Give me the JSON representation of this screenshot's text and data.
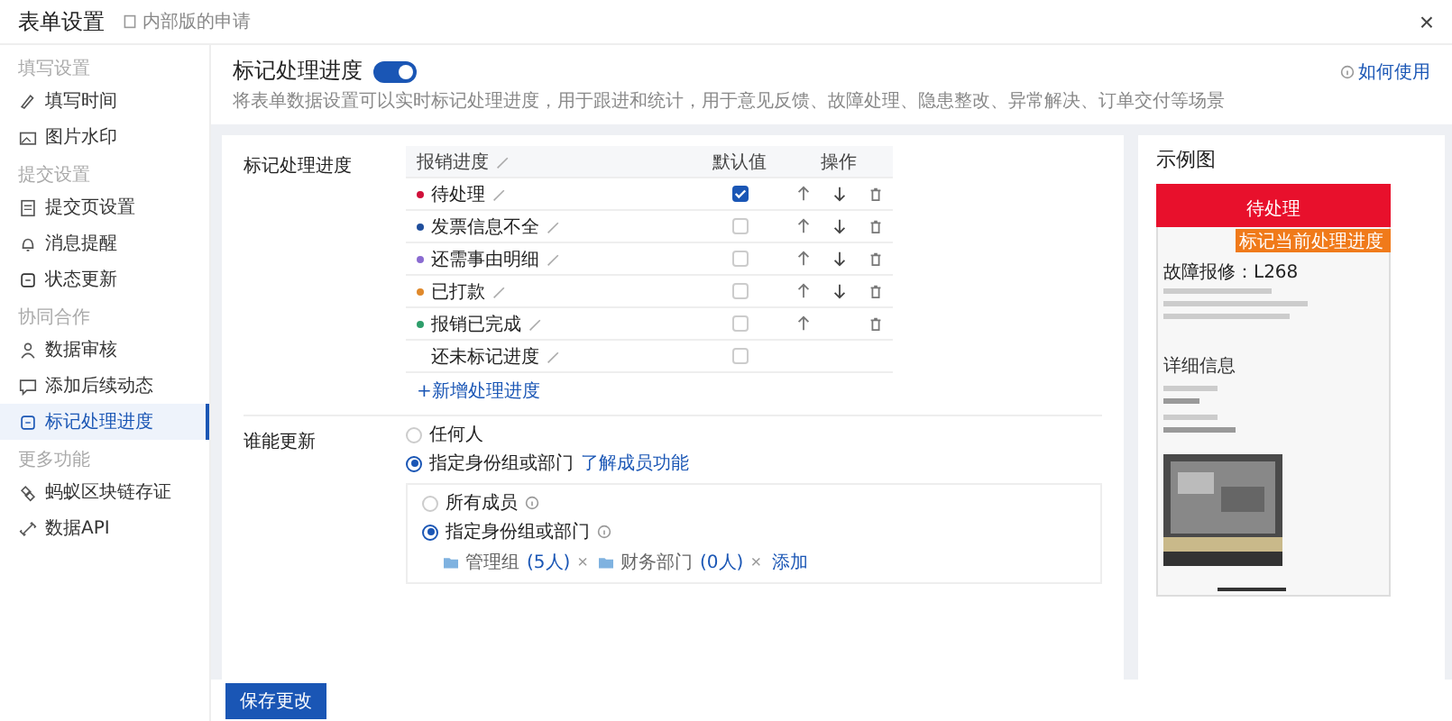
{
  "window": {
    "title": "表单设置",
    "subtitle": "内部版的申请",
    "close": "×"
  },
  "sidebar": {
    "sections": [
      {
        "title": "填写设置",
        "items": [
          {
            "label": "填写时间",
            "selected": false
          },
          {
            "label": "图片水印",
            "selected": false
          }
        ]
      },
      {
        "title": "提交设置",
        "items": [
          {
            "label": "提交页设置",
            "selected": false
          },
          {
            "label": "消息提醒",
            "selected": false
          },
          {
            "label": "状态更新",
            "selected": false
          }
        ]
      },
      {
        "title": "协同合作",
        "items": [
          {
            "label": "数据审核",
            "selected": false
          },
          {
            "label": "添加后续动态",
            "selected": false
          },
          {
            "label": "标记处理进度",
            "selected": true
          }
        ]
      },
      {
        "title": "更多功能",
        "items": [
          {
            "label": "蚂蚁区块链存证",
            "selected": false
          },
          {
            "label": "数据API",
            "selected": false
          }
        ]
      }
    ]
  },
  "section": {
    "title": "标记处理进度",
    "on": true,
    "description": "将表单数据设置可以实时标记处理进度，用于跟进和统计，用于意见反馈、故障处理、隐患整改、异常解决、订单交付等场景",
    "help_link": "如何使用"
  },
  "progress": {
    "label": "标记处理进度",
    "columns": [
      "报销进度",
      "默认值",
      "操作"
    ],
    "rows": [
      {
        "name": "待处理",
        "color": "#d0103a",
        "checked": true,
        "up": true,
        "down": true,
        "delete": true
      },
      {
        "name": "发票信息不全",
        "color": "#1f4e9c",
        "checked": false,
        "up": true,
        "down": true,
        "delete": true
      },
      {
        "name": "还需事由明细",
        "color": "#8a6bd1",
        "checked": false,
        "up": true,
        "down": true,
        "delete": true
      },
      {
        "name": "已打款",
        "color": "#e0892b",
        "checked": false,
        "up": true,
        "down": true,
        "delete": true
      },
      {
        "name": "报销已完成",
        "color": "#2e9e6b",
        "checked": false,
        "up": true,
        "down": false,
        "delete": true
      },
      {
        "name": "还未标记进度",
        "checked": false,
        "up": false,
        "down": false,
        "delete": false
      }
    ],
    "add_link": "+新增处理进度"
  },
  "who_can_update": {
    "label": "谁能更新",
    "options": [
      {
        "label": "任何人",
        "selected": false
      },
      {
        "label": "指定身份组或部门",
        "selected": true,
        "link": "了解成员功能"
      }
    ],
    "sub_options": [
      {
        "label": "所有成员",
        "selected": false
      },
      {
        "label": "指定身份组或部门",
        "selected": true
      }
    ],
    "groups": [
      {
        "name": "管理组",
        "count": "(5人)",
        "remove": "×"
      },
      {
        "name": "财务部门",
        "count": "(0人)",
        "remove": "×"
      }
    ],
    "add": "添加"
  },
  "preview": {
    "title": "示例图",
    "app_title": "待处理",
    "badge": "标记当前处理进度",
    "heading": "故障报修：L268",
    "details": "详细信息"
  },
  "save_button": "保存更改"
}
